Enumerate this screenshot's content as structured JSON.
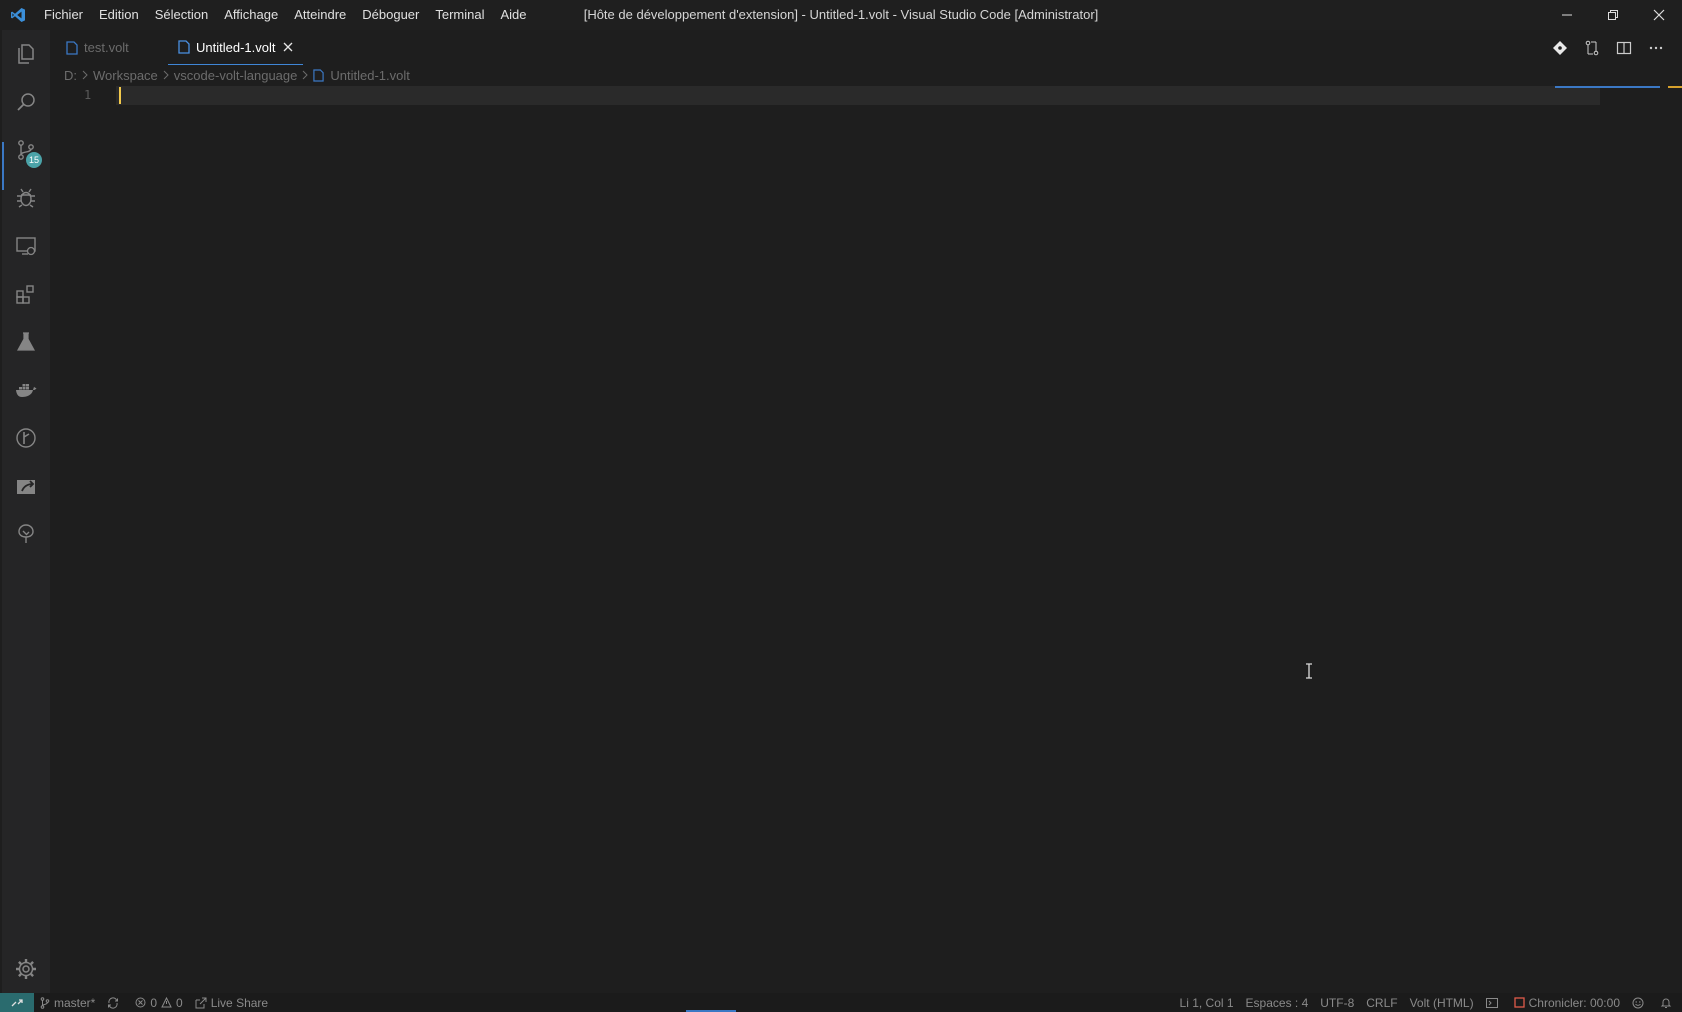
{
  "titlebar": {
    "menu": [
      "Fichier",
      "Edition",
      "Sélection",
      "Affichage",
      "Atteindre",
      "Déboguer",
      "Terminal",
      "Aide"
    ],
    "window_title": "[Hôte de développement d'extension] - Untitled-1.volt - Visual Studio Code [Administrator]"
  },
  "activitybar": {
    "scm_badge": "15"
  },
  "tabs": [
    {
      "label": "test.volt"
    },
    {
      "label": "Untitled-1.volt"
    }
  ],
  "breadcrumb": {
    "drive": "D:",
    "folder1": "Workspace",
    "folder2": "vscode-volt-language",
    "file": "Untitled-1.volt"
  },
  "editor": {
    "line_number": "1"
  },
  "statusbar": {
    "branch": "master*",
    "errors": "0",
    "warnings": "0",
    "live_share": "Live Share",
    "position": "Li 1, Col 1",
    "indent": "Espaces : 4",
    "encoding": "UTF-8",
    "eol": "CRLF",
    "language": "Volt (HTML)",
    "chronicler": "Chronicler: 00:00"
  },
  "colors": {
    "accent": "#3b78c4",
    "cursor": "#f2c94c",
    "background": "#1e1e1e"
  }
}
